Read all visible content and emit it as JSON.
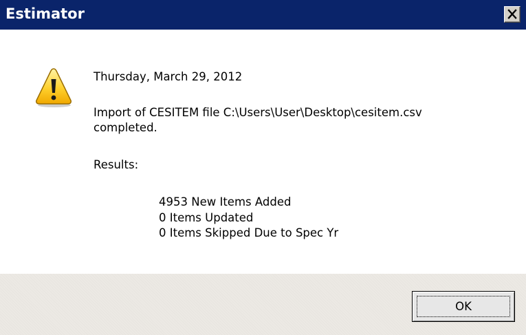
{
  "window": {
    "title": "Estimator",
    "close_icon": "close-icon"
  },
  "message": {
    "icon": "warning-icon",
    "date": "Thursday, March 29, 2012",
    "line1": "Import of CESITEM file C:\\Users\\User\\Desktop\\cesitem.csv",
    "line2": "completed.",
    "results_label": "Results:",
    "results": [
      "4953 New Items Added",
      "0 Items Updated",
      "0 Items Skipped Due to Spec Yr"
    ]
  },
  "buttons": {
    "ok_label": "OK"
  },
  "colors": {
    "titlebar": "#0a246a",
    "footer": "#ece9e4",
    "warning_fill": "#ffc824"
  }
}
